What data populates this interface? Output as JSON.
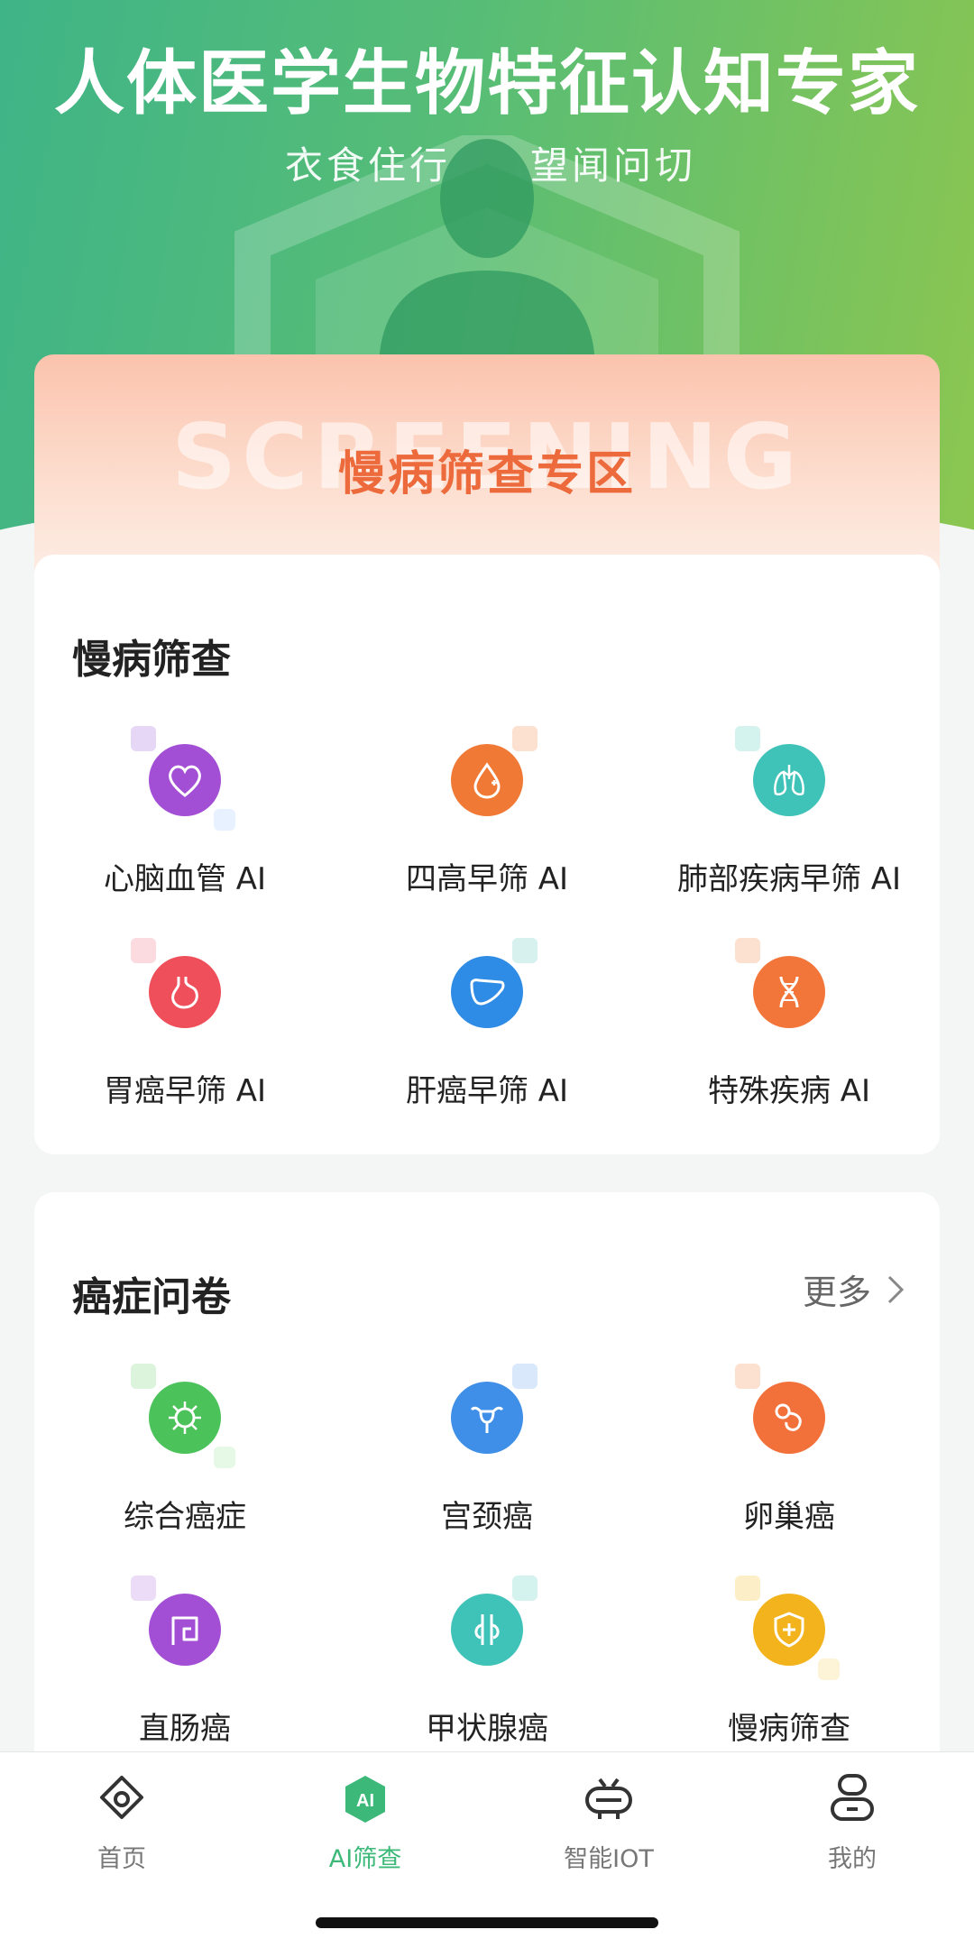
{
  "header": {
    "title": "人体医学生物特征认知专家",
    "subtitle_left": "衣食住行",
    "subtitle_right": "望闻问切"
  },
  "banner": {
    "watermark": "SCREENING",
    "title": "慢病筛查专区"
  },
  "chronic_section": {
    "title": "慢病筛查",
    "items": [
      {
        "label": "心脑血管 AI",
        "icon": "heart-icon",
        "color": "#a24fd6"
      },
      {
        "label": "四高早筛 AI",
        "icon": "blood-drop-icon",
        "color": "#f07a35"
      },
      {
        "label": "肺部疾病早筛 AI",
        "icon": "lungs-icon",
        "color": "#3fc2b8"
      },
      {
        "label": "胃癌早筛 AI",
        "icon": "stomach-icon",
        "color": "#ef4f5a"
      },
      {
        "label": "肝癌早筛 AI",
        "icon": "liver-icon",
        "color": "#2f8ce6"
      },
      {
        "label": "特殊疾病 AI",
        "icon": "dna-icon",
        "color": "#f2763a"
      }
    ]
  },
  "cancer_section": {
    "title": "癌症问卷",
    "more_label": "更多",
    "items": [
      {
        "label": "综合癌症",
        "icon": "virus-icon",
        "color": "#4cc25a"
      },
      {
        "label": "宫颈癌",
        "icon": "uterus-icon",
        "color": "#3f8ee8"
      },
      {
        "label": "卵巢癌",
        "icon": "ovary-icon",
        "color": "#f2703a"
      },
      {
        "label": "直肠癌",
        "icon": "intestine-icon",
        "color": "#a24fd6"
      },
      {
        "label": "甲状腺癌",
        "icon": "thyroid-icon",
        "color": "#3fc2b8"
      },
      {
        "label": "慢病筛查",
        "icon": "shield-plus-icon",
        "color": "#f2b31c"
      }
    ]
  },
  "tabbar": {
    "tabs": [
      {
        "label": "首页",
        "icon": "home-icon"
      },
      {
        "label": "AI筛查",
        "icon": "ai-hexagon-icon",
        "active": true
      },
      {
        "label": "智能IOT",
        "icon": "robot-icon"
      },
      {
        "label": "我的",
        "icon": "user-icon"
      }
    ],
    "active_color": "#3cb878"
  }
}
